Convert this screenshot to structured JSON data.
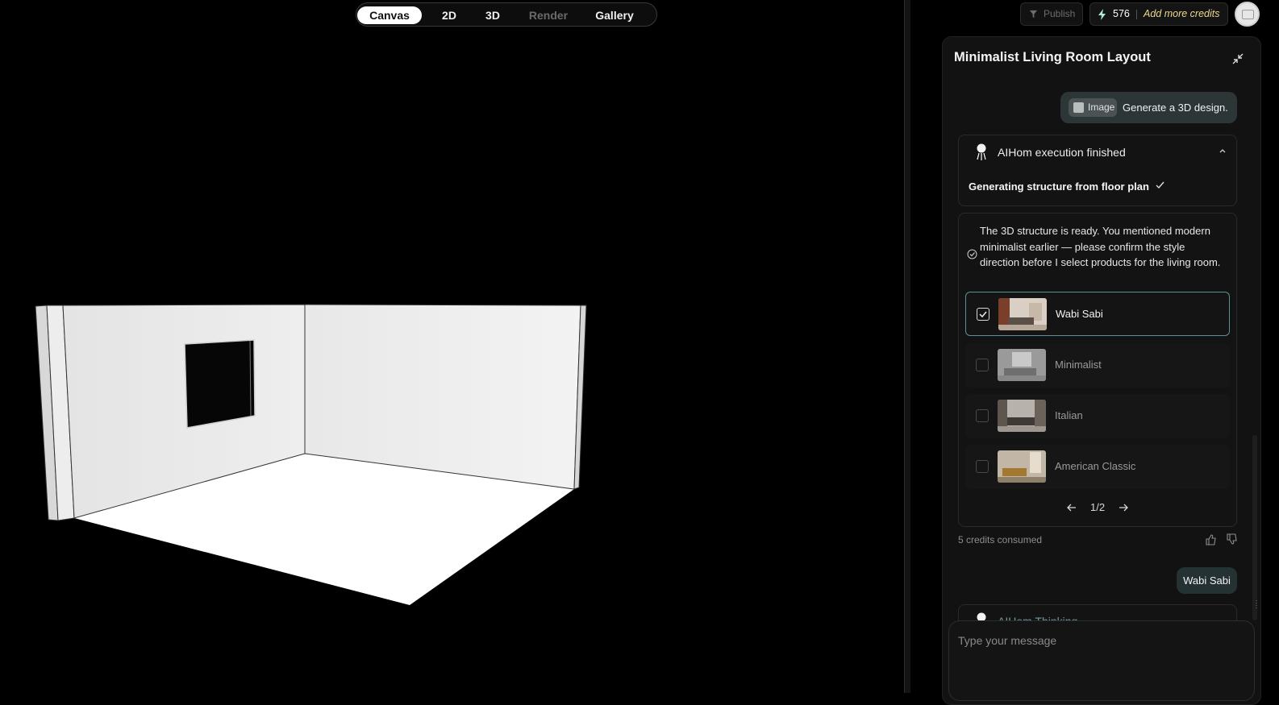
{
  "mode_tabs": [
    {
      "label": "Canvas",
      "state": "active"
    },
    {
      "label": "2D",
      "state": "normal"
    },
    {
      "label": "3D",
      "state": "normal"
    },
    {
      "label": "Render",
      "state": "disabled"
    },
    {
      "label": "Gallery",
      "state": "normal"
    }
  ],
  "toolbar": {
    "publish_label": "Publish",
    "credits_count": "576",
    "add_credits_label": "Add more credits"
  },
  "chat": {
    "title": "Minimalist Living Room Layout",
    "user_prompt": {
      "attachment_label": "Image",
      "text": "Generate a 3D design."
    },
    "execution": {
      "status": "AIHom execution finished",
      "step": "Generating structure from floor plan"
    },
    "confirmation": {
      "message": "The 3D structure is ready. You mentioned modern minimalist earlier — please confirm the style direction before I select products for the living room.",
      "options": [
        {
          "label": "Wabi Sabi",
          "selected": true
        },
        {
          "label": "Minimalist",
          "selected": false
        },
        {
          "label": "Italian",
          "selected": false
        },
        {
          "label": "American Classic",
          "selected": false
        }
      ],
      "page_indicator": "1/2"
    },
    "credits_consumed": "5 credits consumed",
    "user_reply": "Wabi Sabi",
    "thinking_status": "AIHom Thinking",
    "input_placeholder": "Type your message"
  },
  "colors": {
    "background": "#000000",
    "panel": "#121212",
    "accent_credits": "#e9d98e",
    "selected_border": "#5e8f92",
    "user_bubble": "#2c3637"
  }
}
